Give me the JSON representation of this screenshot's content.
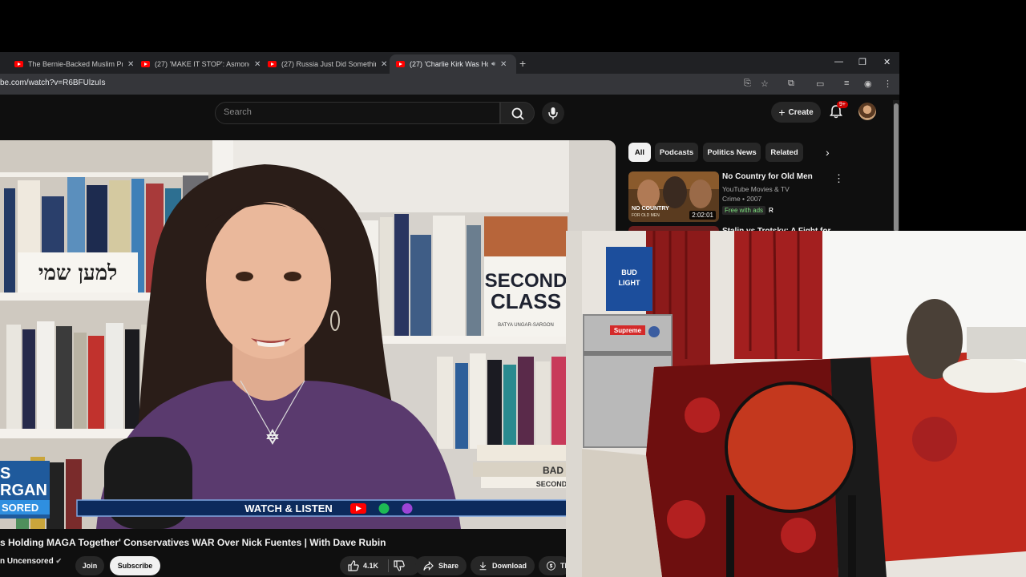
{
  "browser": {
    "tabs": [
      {
        "label": "The Bernie-Backed Muslim Pro"
      },
      {
        "label": "(27) 'MAKE IT STOP': Asmongol"
      },
      {
        "label": "(27) Russia Just Did Something"
      },
      {
        "label": "(27) 'Charlie Kirk Was Holdi"
      }
    ],
    "url": "be.com/watch?v=R6BFUlzuIs"
  },
  "header": {
    "search_placeholder": "Search",
    "create_label": "Create",
    "notification_count": "9+"
  },
  "video": {
    "banner_text": "WATCH & LISTEN",
    "book_title_line1": "SECOND",
    "book_title_line2": "CLASS",
    "book_author": "BATYA UNGAR-SARGON",
    "hebrew_sign": "למען שמי",
    "book_spine_bad": "BAD",
    "book_spine_second": "SECOND",
    "logo_line1": "S",
    "logo_line2": "RGAN",
    "logo_line3": "SORED",
    "title": "s Holding MAGA Together' Conservatives WAR Over Nick Fuentes | With Dave Rubin",
    "channel": "n Uncensored",
    "join_label": "Join",
    "subscribe_label": "Subscribe",
    "likes": "4.1K",
    "share_label": "Share",
    "download_label": "Download",
    "thanks_label": "Th"
  },
  "sidebar": {
    "chips": [
      "All",
      "Podcasts",
      "Politics News",
      "Related"
    ],
    "recommendations": [
      {
        "title": "No Country for Old Men",
        "channel": "YouTube Movies & TV",
        "meta": "Crime • 2007",
        "badge": "Free with ads",
        "rating": "R",
        "duration": "2:02:01",
        "poster_line1": "NO COUNTRY",
        "poster_line2": "FOR OLD MEN"
      },
      {
        "title": "Stalin vs Trotsky: A Fight for"
      }
    ]
  },
  "webcam": {
    "box_label1": "BUD",
    "box_label2": "LIGHT",
    "sticker_text": "Supreme"
  },
  "colors": {
    "youtube_red": "#ff0000",
    "background": "#0f0f0f",
    "chip": "#272727",
    "bedspread_red": "#c0291e"
  }
}
